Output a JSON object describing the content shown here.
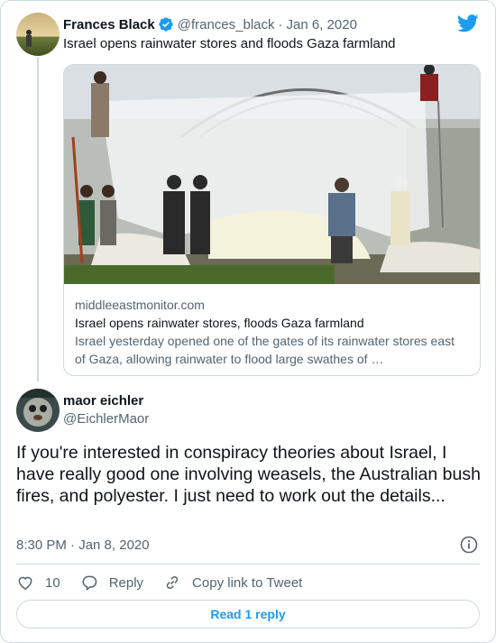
{
  "colors": {
    "accent": "#1d9bf0",
    "muted": "#536471",
    "border": "#cfd9de",
    "text": "#0f1419"
  },
  "parent_tweet": {
    "author_name": "Frances Black",
    "verified": true,
    "handle": "@frances_black",
    "separator": "·",
    "date": "Jan 6, 2020",
    "text": "Israel opens rainwater stores and floods Gaza farmland",
    "link_card": {
      "domain": "middleeastmonitor.com",
      "title": "Israel opens rainwater stores, floods Gaza farmland",
      "description": "Israel yesterday opened one of the gates of its rainwater stores east of Gaza, allowing rainwater to flood large swathes of …"
    }
  },
  "reply_tweet": {
    "author_name": "maor eichler",
    "handle": "@EichlerMaor",
    "text": "If you're interested in conspiracy theories about Israel, I have really good one involving weasels, the Australian bush fires, and polyester. I just need to work out the details...",
    "timestamp": "8:30 PM · Jan 8, 2020"
  },
  "actions": {
    "like_count": "10",
    "reply_label": "Reply",
    "copy_link_label": "Copy link to Tweet"
  },
  "read_replies_label": "Read 1 reply",
  "icons": [
    "twitter-bird-icon",
    "verified-badge-icon",
    "info-icon",
    "heart-icon",
    "reply-bubble-icon",
    "link-icon"
  ]
}
